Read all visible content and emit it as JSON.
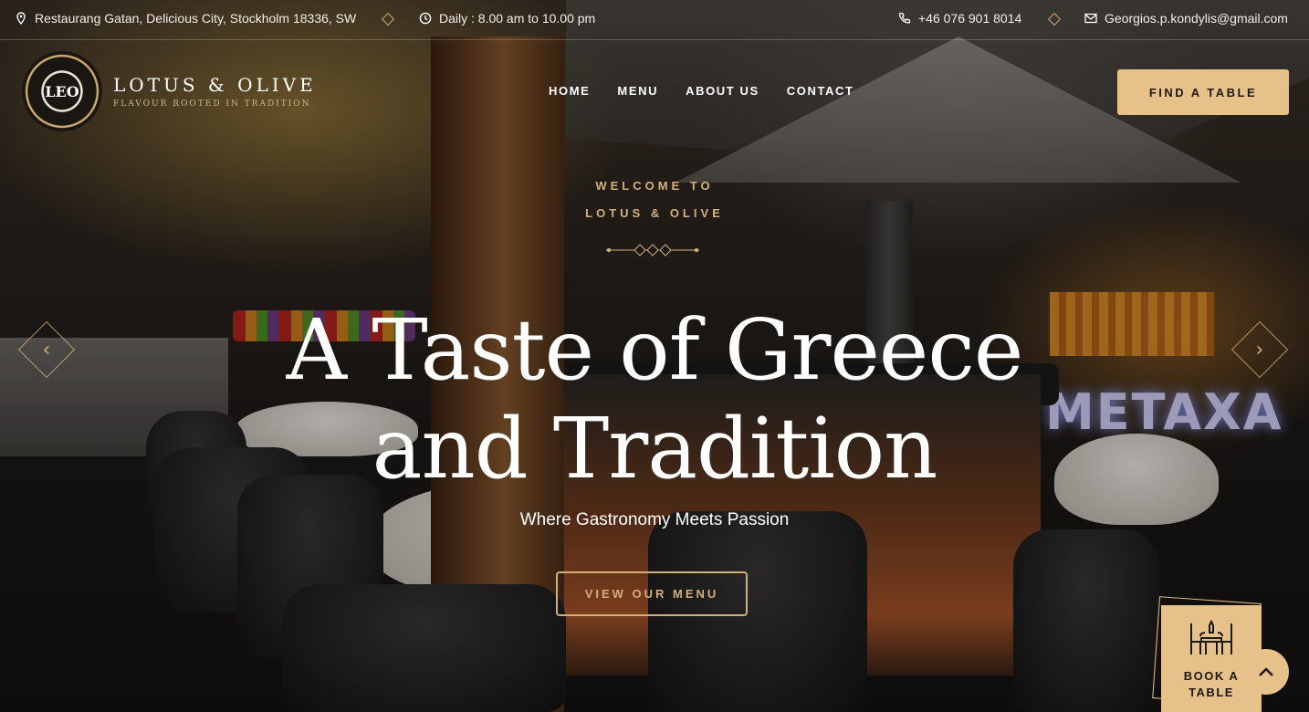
{
  "topbar": {
    "address": "Restaurang Gatan, Delicious City, Stockholm 18336, SW",
    "hours": "Daily : 8.00 am to 10.00 pm",
    "phone": "+46 076 901 8014",
    "email": "Georgios.p.kondylis@gmail.com"
  },
  "brand": {
    "badge": "LEO",
    "name": "LOTUS & OLIVE",
    "tagline": "FLAVOUR ROOTED IN TRADITION"
  },
  "nav": {
    "items": [
      "HOME",
      "MENU",
      "ABOUT US",
      "CONTACT"
    ],
    "cta": "FIND A TABLE"
  },
  "hero": {
    "welcome_line1": "WELCOME TO",
    "welcome_line2": "LOTUS & OLIVE",
    "title_line1": "A Taste of Greece",
    "title_line2": "and Tradition",
    "subtitle": "Where Gastronomy Meets Passion",
    "button": "VIEW OUR MENU",
    "sign": "METAXA"
  },
  "widgets": {
    "book_line1": "BOOK A",
    "book_line2": "TABLE"
  },
  "colors": {
    "accent": "#e7c18a",
    "gold_text": "#d3b07a"
  },
  "icons": [
    "location-pin-icon",
    "clock-icon",
    "phone-icon",
    "mail-icon",
    "chevron-left-icon",
    "chevron-right-icon",
    "dining-table-icon",
    "chevron-up-icon"
  ]
}
